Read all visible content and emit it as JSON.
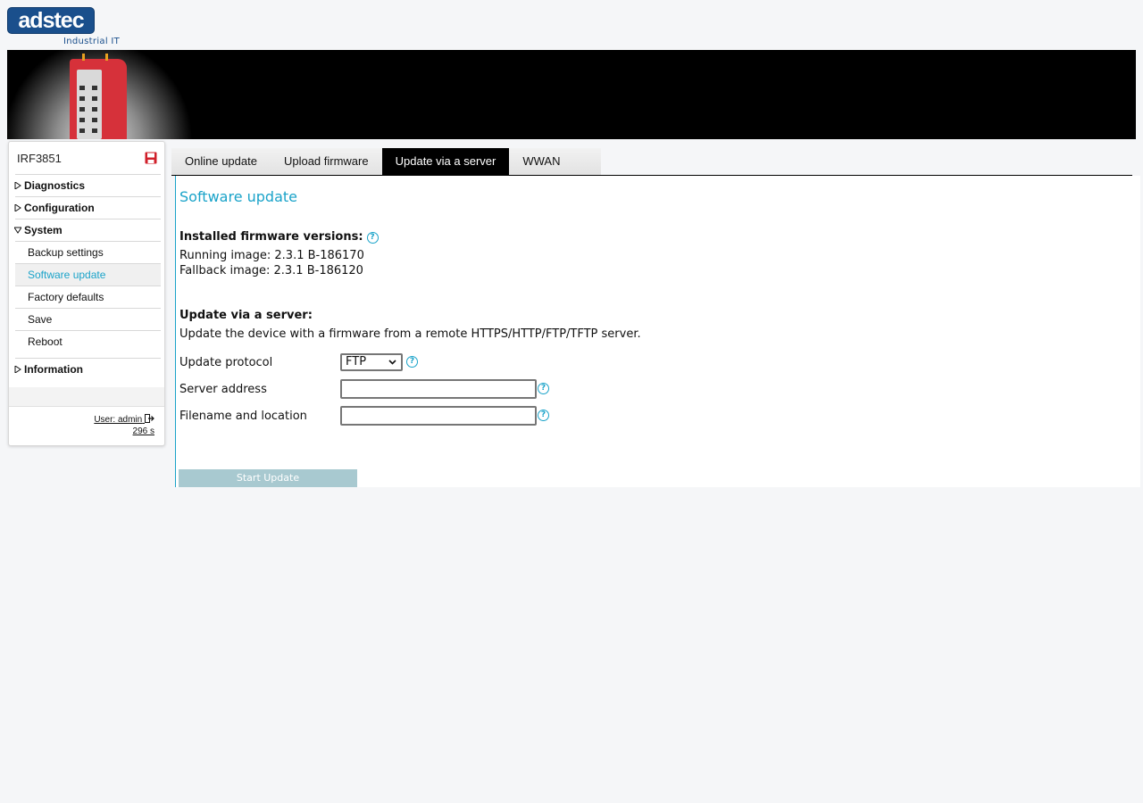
{
  "branding": {
    "logo_text": "adstec",
    "tagline": "Industrial IT"
  },
  "sidebar": {
    "device_name": "IRF3851",
    "nav": [
      {
        "label": "Diagnostics",
        "expanded": false
      },
      {
        "label": "Configuration",
        "expanded": false
      },
      {
        "label": "System",
        "expanded": true
      },
      {
        "label": "Information",
        "expanded": false
      }
    ],
    "system_items": [
      "Backup settings",
      "Software update",
      "Factory defaults",
      "Save",
      "Reboot"
    ],
    "active_item": "Software update",
    "user": "User: admin",
    "timer": "296 s"
  },
  "tabs": [
    {
      "label": "Online update",
      "active": false
    },
    {
      "label": "Upload firmware",
      "active": false
    },
    {
      "label": "Update via a server",
      "active": true
    },
    {
      "label": "WWAN",
      "active": false
    }
  ],
  "content": {
    "title": "Software update",
    "installed_heading": "Installed firmware versions:",
    "running_image": "Running image: 2.3.1 B-186170",
    "fallback_image": "Fallback image: 2.3.1 B-186120",
    "server_heading": "Update via a server:",
    "server_desc": "Update the device with a firmware from a remote HTTPS/HTTP/FTP/TFTP server.",
    "form": {
      "protocol_label": "Update protocol",
      "protocol_value": "FTP",
      "server_label": "Server address",
      "server_value": "",
      "filename_label": "Filename and location",
      "filename_value": ""
    },
    "start_button": "Start Update"
  },
  "colors": {
    "accent": "#1aa3c9",
    "brand": "#1a4f8c",
    "button_disabled": "#a8c9d0",
    "save_icon": "#d01f2a"
  },
  "icons": {
    "save": "floppy-save-icon",
    "help": "question-circle-icon",
    "logout": "logout-icon",
    "collapsed": "triangle-right-icon",
    "expanded": "triangle-down-icon"
  }
}
